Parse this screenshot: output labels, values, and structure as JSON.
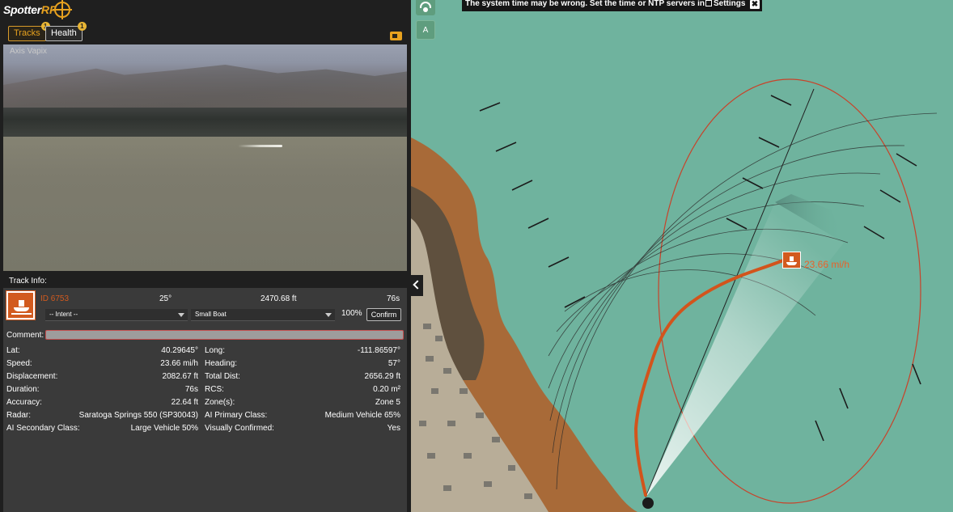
{
  "app": {
    "logo_text_a": "Spotter",
    "logo_text_b": "RF"
  },
  "tabs": [
    {
      "label": "Tracks",
      "badge": "1"
    },
    {
      "label": "Health",
      "badge": "1"
    }
  ],
  "camera": {
    "label": "Axis Vapix"
  },
  "track_info": {
    "title": "Track Info:",
    "id": "ID 6753",
    "bearing": "25°",
    "distance": "2470.68 ft",
    "age": "76s",
    "intent_placeholder": "-- Intent --",
    "classification": "Small Boat",
    "confidence": "100%",
    "confirm_label": "Confirm",
    "comment_label": "Comment:",
    "fields": {
      "lat_label": "Lat:",
      "lat": "40.29645°",
      "long_label": "Long:",
      "long": "-111.86597°",
      "speed_label": "Speed:",
      "speed": "23.66 mi/h",
      "heading_label": "Heading:",
      "heading": "57°",
      "displacement_label": "Displacement:",
      "displacement": "2082.67 ft",
      "total_dist_label": "Total Dist:",
      "total_dist": "2656.29 ft",
      "duration_label": "Duration:",
      "duration": "76s",
      "rcs_label": "RCS:",
      "rcs": "0.20 m²",
      "accuracy_label": "Accuracy:",
      "accuracy": "22.64 ft",
      "zones_label": "Zone(s):",
      "zones": "Zone 5",
      "radar_label": "Radar:",
      "radar": "Saratoga Springs 550 (SP30043)",
      "ai_primary_label": "AI Primary Class:",
      "ai_primary": "Medium Vehicle 65%",
      "ai_secondary_label": "AI Secondary Class:",
      "ai_secondary": "Large Vehicle 50%",
      "visually_confirmed_label": "Visually Confirmed:",
      "visually_confirmed": "Yes"
    }
  },
  "map": {
    "layer_button_label": "A",
    "banner_text": "The system time may be wrong. Set the time or NTP servers in",
    "banner_link": "Settings",
    "banner_close": "✖",
    "target_speed": "23.66 mi/h"
  },
  "colors": {
    "accent": "#e8a21f",
    "track": "#d25a1e",
    "water": "#6fb39e"
  }
}
